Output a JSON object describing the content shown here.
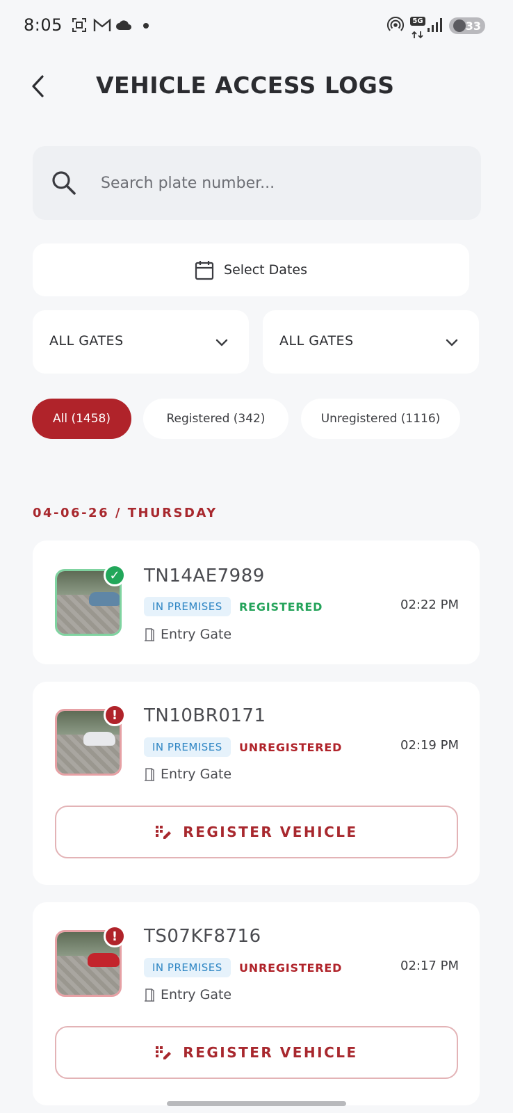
{
  "status_bar": {
    "time": "8:05",
    "network": "5G",
    "battery": "33",
    "icons": [
      "screenshot-icon",
      "gmail-icon",
      "cloud-icon",
      "hotspot-icon",
      "5g-icon",
      "signal-icon",
      "battery-icon"
    ]
  },
  "header": {
    "title": "VEHICLE ACCESS LOGS",
    "back_icon": "back-arrow-icon"
  },
  "search": {
    "placeholder": "Search plate number...",
    "value": ""
  },
  "date_picker": {
    "label": "Select Dates",
    "icon": "calendar-icon"
  },
  "gate_filters": [
    {
      "label": "ALL GATES"
    },
    {
      "label": "ALL GATES"
    }
  ],
  "filter_chips": [
    {
      "label": "All (1458)",
      "active": true
    },
    {
      "label": "Registered (342)",
      "active": false
    },
    {
      "label": "Unregistered (1116)",
      "active": false
    }
  ],
  "section": {
    "date_heading": "04-06-26 / THURSDAY"
  },
  "logs": [
    {
      "plate": "TN14AE7989",
      "location": "IN PREMISES",
      "status": "REGISTERED",
      "time": "02:22 PM",
      "gate": "Entry Gate",
      "car_color": "#5f86a6"
    },
    {
      "plate": "TN10BR0171",
      "location": "IN PREMISES",
      "status": "UNREGISTERED",
      "time": "02:19 PM",
      "gate": "Entry Gate",
      "action": "REGISTER VEHICLE",
      "car_color": "#e8e9ec"
    },
    {
      "plate": "TS07KF8716",
      "location": "IN PREMISES",
      "status": "UNREGISTERED",
      "time": "02:17 PM",
      "gate": "Entry Gate",
      "action": "REGISTER VEHICLE",
      "car_color": "#c3242c"
    }
  ],
  "colors": {
    "accent": "#b0232a",
    "registered": "#24a35a",
    "premises_tag": "#2f86c4",
    "background": "#f6f7f9"
  }
}
